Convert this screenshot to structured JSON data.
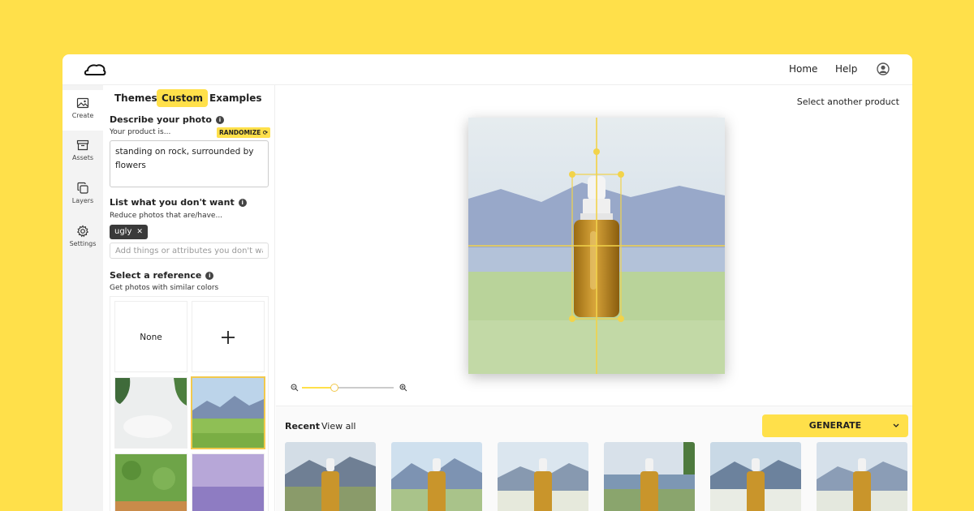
{
  "nav": {
    "home": "Home",
    "help": "Help"
  },
  "rail": {
    "create": "Create",
    "assets": "Assets",
    "layers": "Layers",
    "settings": "Settings"
  },
  "tabs": [
    "Themes",
    "Custom",
    "Examples"
  ],
  "describe": {
    "title": "Describe your photo",
    "subtitle": "Your product is...",
    "randomize": "RANDOMIZE",
    "value": "standing on rock, surrounded by flowers"
  },
  "exclude": {
    "title": "List what you don't want",
    "subtitle": "Reduce photos that are/have...",
    "chips": [
      "ugly"
    ],
    "placeholder": "Add things or attributes you don't want"
  },
  "reference": {
    "title": "Select a reference",
    "subtitle": "Get photos with similar colors",
    "none_label": "None"
  },
  "canvas": {
    "select_product": "Select another product"
  },
  "recent": {
    "title": "Recent",
    "view_all": "View all",
    "generate": "GENERATE"
  },
  "colors": {
    "accent": "#FFE04A",
    "background": "#FFE04A"
  }
}
